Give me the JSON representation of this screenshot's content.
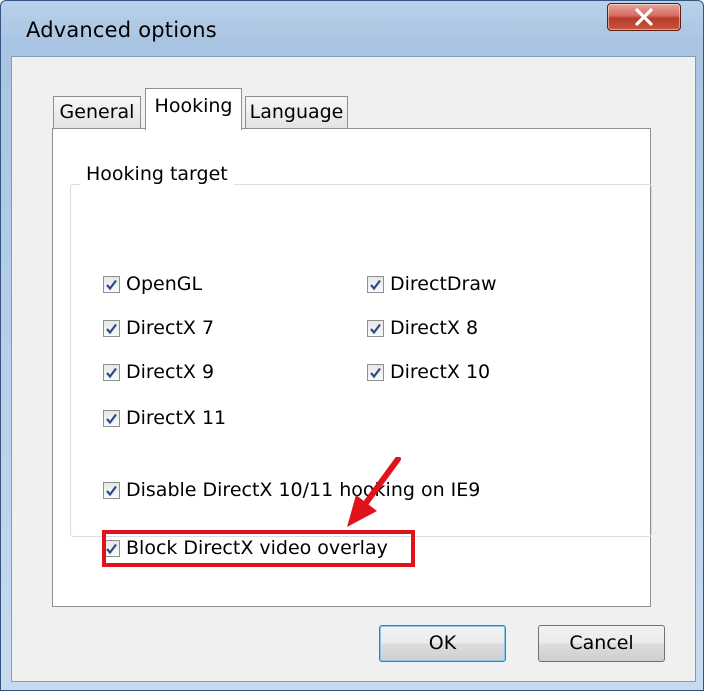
{
  "window": {
    "title": "Advanced options"
  },
  "tabs": [
    {
      "label": "General",
      "active": false
    },
    {
      "label": "Hooking",
      "active": true
    },
    {
      "label": "Language",
      "active": false
    }
  ],
  "group": {
    "legend": "Hooking target",
    "checkboxes": [
      {
        "label": "OpenGL",
        "checked": true
      },
      {
        "label": "DirectDraw",
        "checked": true
      },
      {
        "label": "DirectX 7",
        "checked": true
      },
      {
        "label": "DirectX 8",
        "checked": true
      },
      {
        "label": "DirectX 9",
        "checked": true
      },
      {
        "label": "DirectX 10",
        "checked": true
      },
      {
        "label": "DirectX 11",
        "checked": true
      },
      {
        "label": "Disable DirectX 10/11 hooking on IE9",
        "checked": true
      },
      {
        "label": "Block DirectX video overlay",
        "checked": true
      }
    ]
  },
  "buttons": {
    "ok": "OK",
    "cancel": "Cancel"
  },
  "colors": {
    "highlight": "#e0121a",
    "close_button": "#c9493a"
  }
}
